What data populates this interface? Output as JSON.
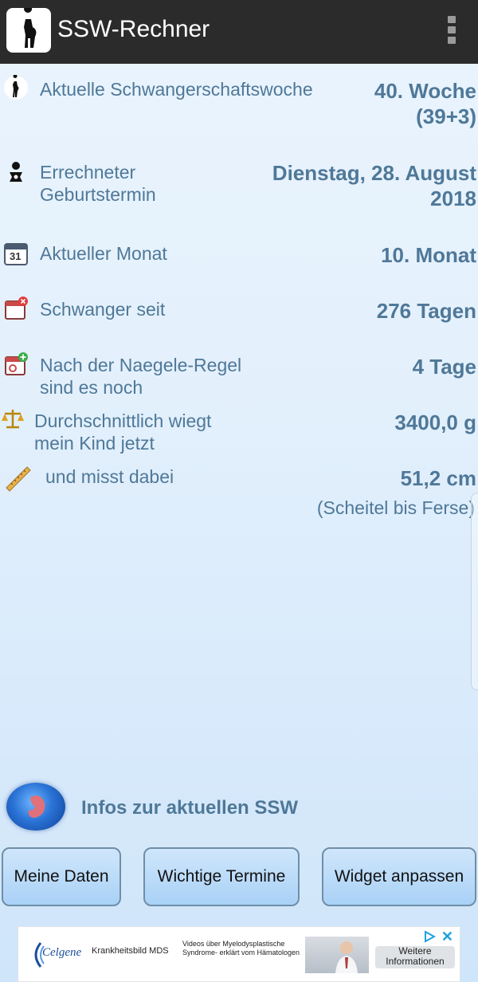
{
  "appbar": {
    "title": "SSW-Rechner"
  },
  "rows": [
    {
      "label_line1": "Aktuelle Schwangerschaftswoche",
      "label_line2": "",
      "value_line1": "40. Woche",
      "value_line2": "(39+3)"
    },
    {
      "label_line1": "Errechneter",
      "label_line2": "Geburtstermin",
      "value_line1": "Dienstag, 28. August",
      "value_line2": "2018"
    },
    {
      "label_line1": "Aktueller Monat",
      "label_line2": "",
      "value_line1": "10. Monat",
      "value_line2": ""
    },
    {
      "label_line1": "Schwanger seit",
      "label_line2": "",
      "value_line1": "276 Tagen",
      "value_line2": ""
    },
    {
      "label_line1": "Nach der Naegele-Regel",
      "label_line2": "sind es noch",
      "value_line1": "4 Tage",
      "value_line2": ""
    },
    {
      "label_line1": "Durchschnittlich wiegt",
      "label_line2": "mein Kind jetzt",
      "value_line1": "3400,0 g",
      "value_line2": ""
    },
    {
      "label_line1": "und misst dabei",
      "label_line2": "",
      "value_line1": "51,2 cm",
      "value_line2": "(Scheitel bis Ferse)"
    }
  ],
  "calendar_icon_text": "31",
  "info_link": {
    "label": "Infos zur aktuellen SSW"
  },
  "buttons": {
    "meine_daten": "Meine Daten",
    "wichtige_termine": "Wichtige Termine",
    "widget_anpassen": "Widget anpassen"
  },
  "ad": {
    "brand": "Celgene",
    "headline": "Krankheitsbild MDS",
    "description": "Videos über Myelodysplastische Syndrome- erklärt vom Hämatologen",
    "cta": "Weitere Informationen"
  },
  "colors": {
    "text": "#4f7898",
    "appbar": "#2b2b2b"
  }
}
